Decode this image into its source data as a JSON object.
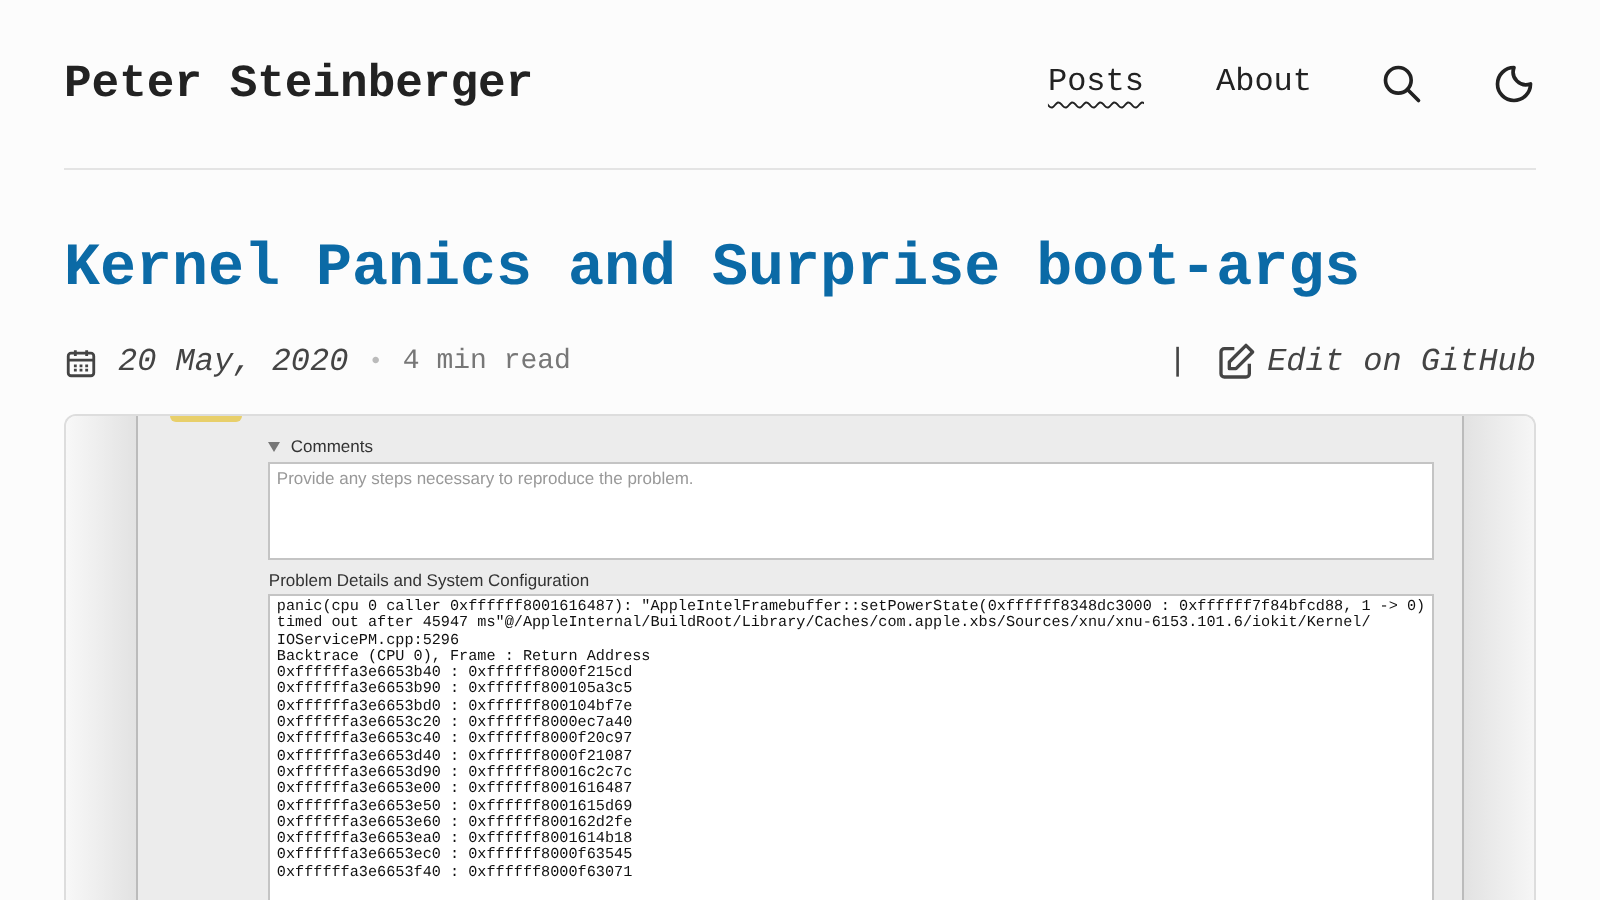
{
  "header": {
    "site_title": "Peter Steinberger",
    "nav": [
      {
        "label": "Posts",
        "selected": true
      },
      {
        "label": "About",
        "selected": false
      }
    ]
  },
  "post": {
    "title": "Kernel Panics and Surprise boot-args",
    "date": "20 May, 2020",
    "separator": "•",
    "reading_time": "4 min read",
    "divider": "|",
    "edit_link": "Edit on GitHub"
  },
  "screenshot": {
    "comments_label": "Comments",
    "comments_placeholder": "Provide any steps necessary to reproduce the problem.",
    "details_label": "Problem Details and System Configuration",
    "log_lines": [
      "panic(cpu 0 caller 0xffffff8001616487): \"AppleIntelFramebuffer::setPowerState(0xffffff8348dc3000 : 0xffffff7f84bfcd88, 1 -> 0)",
      "timed out after 45947 ms\"@/AppleInternal/BuildRoot/Library/Caches/com.apple.xbs/Sources/xnu/xnu-6153.101.6/iokit/Kernel/",
      "IOServicePM.cpp:5296",
      "Backtrace (CPU 0), Frame : Return Address",
      "0xffffffa3e6653b40 : 0xffffff8000f215cd",
      "0xffffffa3e6653b90 : 0xffffff800105a3c5",
      "0xffffffa3e6653bd0 : 0xffffff800104bf7e",
      "0xffffffa3e6653c20 : 0xffffff8000ec7a40",
      "0xffffffa3e6653c40 : 0xffffff8000f20c97",
      "0xffffffa3e6653d40 : 0xffffff8000f21087",
      "0xffffffa3e6653d90 : 0xffffff80016c2c7c",
      "0xffffffa3e6653e00 : 0xffffff8001616487",
      "0xffffffa3e6653e50 : 0xffffff8001615d69",
      "0xffffffa3e6653e60 : 0xffffff800162d2fe",
      "0xffffffa3e6653ea0 : 0xffffff8001614b18",
      "0xffffffa3e6653ec0 : 0xffffff8000f63545",
      "0xffffffa3e6653f40 : 0xffffff8000f63071"
    ]
  }
}
